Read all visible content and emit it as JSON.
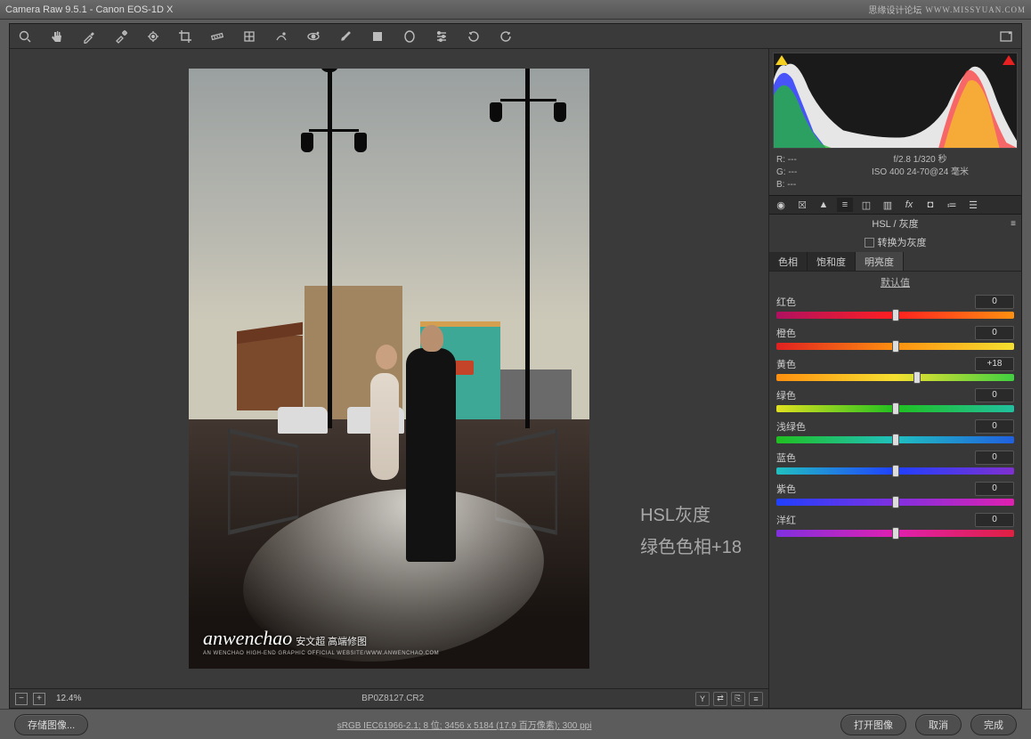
{
  "titlebar": {
    "title": "Camera Raw 9.5.1  -  Canon EOS-1D X",
    "forum": "思缘设计论坛",
    "site": "WWW.MISSYUAN.COM"
  },
  "exif": {
    "r": "R:    ---",
    "g": "G:    ---",
    "b": "B:    ---",
    "aperture": "f/2.8  1/320 秒",
    "iso": "ISO 400    24-70@24 毫米"
  },
  "panel": {
    "title": "HSL / 灰度",
    "convert": "转换为灰度",
    "tabs": {
      "hue": "色相",
      "sat": "饱和度",
      "lum": "明亮度"
    },
    "default": "默认值"
  },
  "sliders": [
    {
      "label": "红色",
      "value": "0",
      "pos": 50,
      "grad": "linear-gradient(90deg,#b01060,#ff2020,#ff9010)"
    },
    {
      "label": "橙色",
      "value": "0",
      "pos": 50,
      "grad": "linear-gradient(90deg,#e02020,#ff9010,#f5e030)"
    },
    {
      "label": "黄色",
      "value": "+18",
      "pos": 59,
      "grad": "linear-gradient(90deg,#ff9010,#f5e030,#40d040)"
    },
    {
      "label": "绿色",
      "value": "0",
      "pos": 50,
      "grad": "linear-gradient(90deg,#e0e020,#20c020,#20c0a0)"
    },
    {
      "label": "浅绿色",
      "value": "0",
      "pos": 50,
      "grad": "linear-gradient(90deg,#20c020,#20c0c0,#2060e0)"
    },
    {
      "label": "蓝色",
      "value": "0",
      "pos": 50,
      "grad": "linear-gradient(90deg,#20c0c0,#2040ff,#8030d0)"
    },
    {
      "label": "紫色",
      "value": "0",
      "pos": 50,
      "grad": "linear-gradient(90deg,#2040ff,#8030e0,#e020b0)"
    },
    {
      "label": "洋红",
      "value": "0",
      "pos": 50,
      "grad": "linear-gradient(90deg,#8030e0,#e020b0,#e02040)"
    }
  ],
  "overlay": {
    "line1": "HSL灰度",
    "line2": "绿色色相+18"
  },
  "watermark": {
    "name": "anwenchao",
    "sub": "安文超 高端修图",
    "line": "AN WENCHAO HIGH-END GRAPHIC OFFICIAL WEBSITE/WWW.ANWENCHAO.COM"
  },
  "preview_footer": {
    "zoom": "12.4%",
    "filename": "BP0Z8127.CR2"
  },
  "bottom": {
    "save": "存储图像...",
    "info": "sRGB IEC61966-2.1; 8 位; 3456 x 5184 (17.9 百万像素); 300 ppi",
    "open": "打开图像",
    "cancel": "取消",
    "done": "完成"
  }
}
